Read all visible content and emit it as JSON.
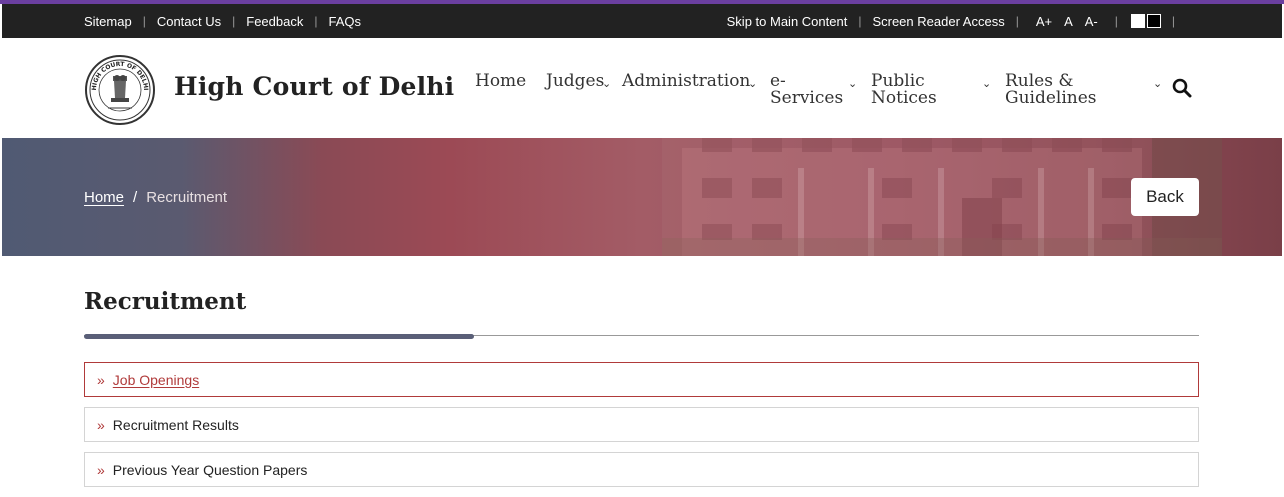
{
  "utility": {
    "left_links": [
      "Sitemap",
      "Contact Us",
      "Feedback",
      "FAQs"
    ],
    "skip": "Skip to Main Content",
    "screen_reader": "Screen Reader Access",
    "font_larger": "A+",
    "font_normal": "A",
    "font_smaller": "A-"
  },
  "header": {
    "site_title": "High Court of Delhi",
    "emblem_text": "HIGH COURT OF DELHI"
  },
  "nav": {
    "home": "Home",
    "judges": "Judges",
    "administration": "Administration",
    "eservices_line1": "e-",
    "eservices_line2": "Services",
    "public_line1": "Public",
    "public_line2": "Notices",
    "rules_line1": "Rules &",
    "rules_line2": "Guidelines"
  },
  "breadcrumb": {
    "home": "Home",
    "separator": "/",
    "current": "Recruitment"
  },
  "back_label": "Back",
  "page_title": "Recruitment",
  "list_items": [
    {
      "label": "Job Openings",
      "active": true
    },
    {
      "label": "Recruitment Results",
      "active": false
    },
    {
      "label": "Previous Year Question Papers",
      "active": false
    }
  ],
  "colors": {
    "accent": "#b03a3a",
    "top_bar": "#222222",
    "title_underline": "#5a5f78"
  }
}
